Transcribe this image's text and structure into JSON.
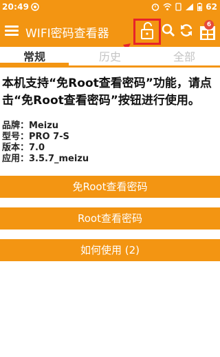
{
  "statusbar": {
    "time": "20:49",
    "battery": "62"
  },
  "appbar": {
    "title": "WIFI密码查看器",
    "badge": "6"
  },
  "tabs": [
    {
      "label": "常规"
    },
    {
      "label": "历史"
    },
    {
      "label": "全部"
    }
  ],
  "instructions": "本机支持“免Root查看密码”功能，请点击“免Root查看密码”按钮进行使用。",
  "device": {
    "brand": "品牌：Meizu",
    "model": "型号：PRO 7-S",
    "version": "版本：7.0",
    "app": "应用：3.5.7_meizu"
  },
  "buttons": {
    "no_root": "免Root查看密码",
    "root": "Root查看密码",
    "how_to": "如何使用 (2)"
  },
  "colors": {
    "accent": "#f39512",
    "highlight": "#e7232a"
  }
}
